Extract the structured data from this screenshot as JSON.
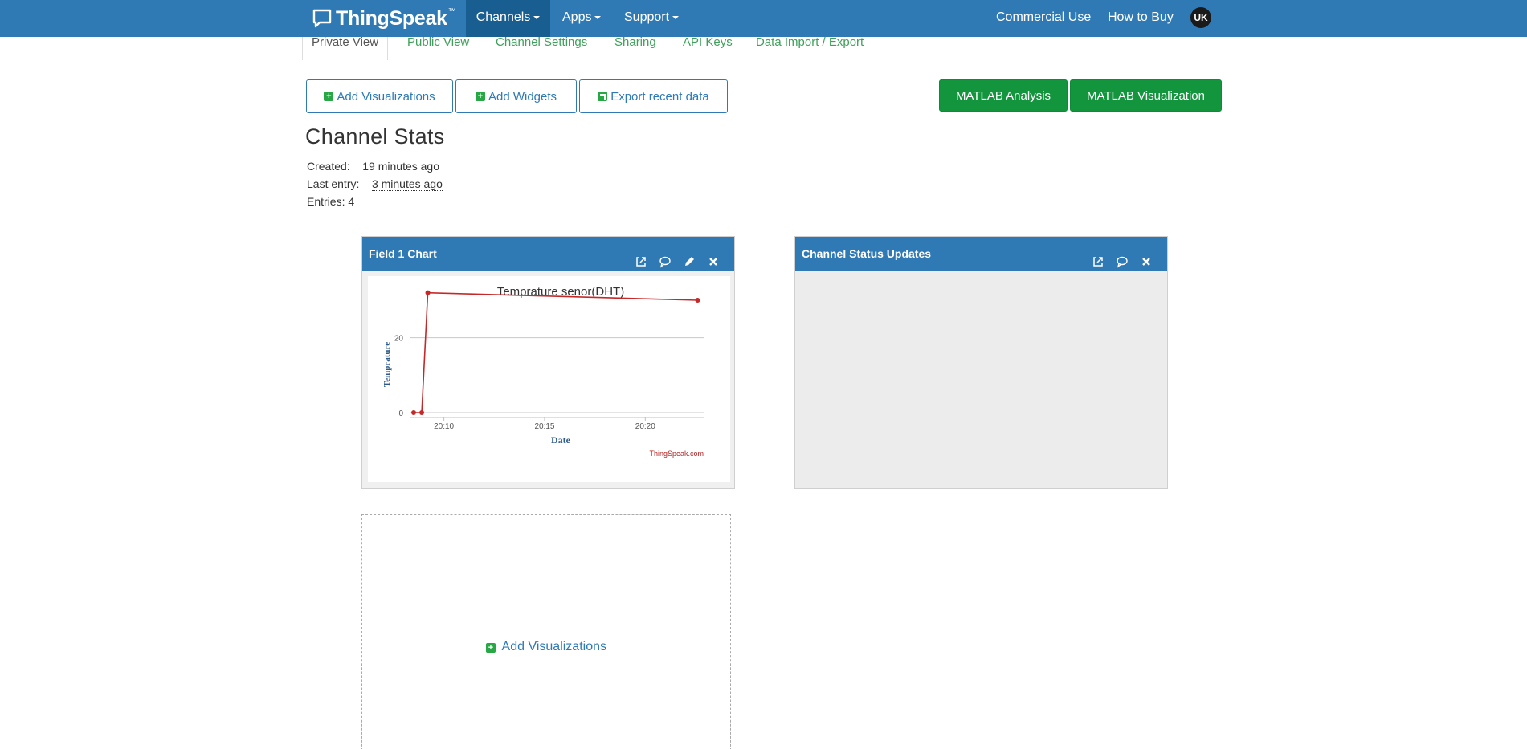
{
  "navbar": {
    "brand": "ThingSpeak",
    "brand_tm": "™",
    "items": [
      "Channels",
      "Apps",
      "Support"
    ],
    "right": [
      "Commercial Use",
      "How to Buy"
    ],
    "avatar": "UK",
    "active_color": "#195e90",
    "bar_color": "#2f7ab5"
  },
  "tabs": [
    "Private View",
    "Public View",
    "Channel Settings",
    "Sharing",
    "API Keys",
    "Data Import / Export"
  ],
  "actions": {
    "add_visualizations": "Add Visualizations",
    "add_widgets": "Add Widgets",
    "export_recent": "Export recent data",
    "matlab_analysis": "MATLAB Analysis",
    "matlab_visualization": "MATLAB Visualization"
  },
  "stats": {
    "title": "Channel Stats",
    "created_label": "Created:",
    "created_value": "19 minutes ago",
    "last_entry_label": "Last entry:",
    "last_entry_value": "3 minutes ago",
    "entries_label": "Entries:",
    "entries_value": "4"
  },
  "widgets": {
    "chart_title": "Field 1 Chart",
    "status_title": "Channel Status Updates",
    "icons": [
      "external-link-icon",
      "comment-icon",
      "pencil-icon",
      "close-icon"
    ]
  },
  "empty_slot": {
    "label": "Add Visualizations"
  },
  "chart_data": {
    "type": "line",
    "title": "Temprature senor(DHT)",
    "xlabel": "Date",
    "ylabel": "Temprature",
    "credit": "ThingSpeak.com",
    "x_ticks": [
      "20:10",
      "20:15",
      "20:20"
    ],
    "y_ticks": [
      "0",
      "20"
    ],
    "x_tick_minutes": [
      10,
      15,
      20
    ],
    "y_tick_values": [
      0,
      20
    ],
    "x_unit": "minutes past 20:00",
    "xlim": [
      8.3,
      22.9
    ],
    "ylim": [
      0,
      30
    ],
    "grid": true,
    "line_color": "#c62828",
    "series": [
      {
        "x": [
          8.5,
          8.9,
          9.2,
          22.6
        ],
        "values": [
          0,
          0,
          32,
          30
        ]
      }
    ]
  }
}
